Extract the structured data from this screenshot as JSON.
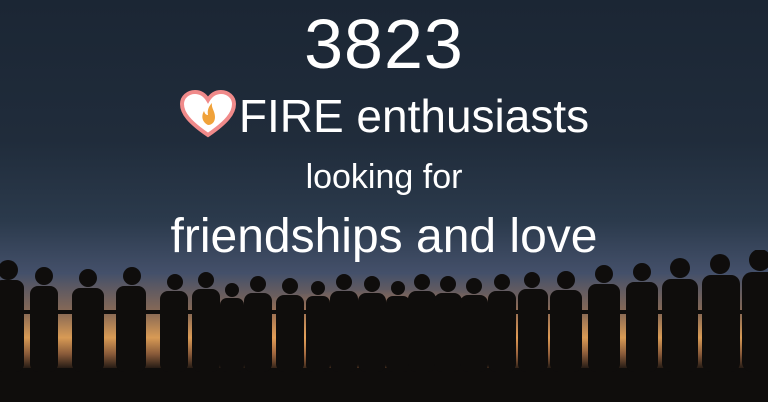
{
  "headline": {
    "count": "3823",
    "audience": "FIRE enthusiasts",
    "connector": "looking for",
    "goal": "friendships and love"
  },
  "icons": {
    "badge": "heart-flame-icon"
  },
  "colors": {
    "text": "#ffffff",
    "heart_outline": "#f08a8a",
    "flame": "#f0a23a",
    "sky_top": "#1b2634",
    "horizon": "#d89a55",
    "silhouette": "#0f0d0c"
  }
}
